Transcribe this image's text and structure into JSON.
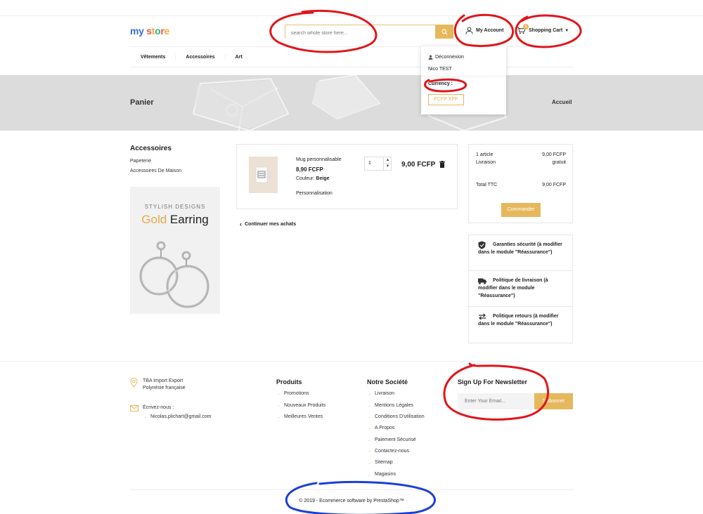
{
  "header": {
    "logo_parts": [
      "m",
      "y",
      " ",
      "s",
      "t",
      "o",
      "r",
      "e"
    ],
    "logo_text": "my store",
    "search_placeholder": "search whole store here...",
    "account_label": "My Account",
    "cart_label": "Shopping Cart",
    "cart_count": "1"
  },
  "nav": {
    "items": [
      "Vêtements",
      "Accessoires",
      "Art"
    ]
  },
  "account_menu": {
    "logout": "Déconnexion",
    "user": "Nico TEST",
    "currency_label": "Currency :",
    "currency_value": "FCFP  XPF"
  },
  "banner": {
    "title": "Panier",
    "home": "Accueil"
  },
  "sidebar": {
    "title": "Accessoires",
    "items": [
      "Papeterie",
      "Accessoires De Maison"
    ],
    "promo_sub": "STYLISH DESIGNS",
    "promo_gold": "Gold",
    "promo_black": "Earring"
  },
  "cart_line": {
    "name": "Mug personnalisable",
    "price": "8,90 FCFP",
    "color_label": "Couleur:",
    "color_value": "Beige",
    "customization": "Personnalisation",
    "qty": "1",
    "total": "9,00 FCFP"
  },
  "continue_label": "Continuer mes achats",
  "summary": {
    "rows": [
      {
        "label": "1 article",
        "value": "9,00 FCFP"
      },
      {
        "label": "Livraison",
        "value": "gratuit"
      },
      {
        "label": "Total TTC",
        "value": "9,00 FCFP"
      }
    ],
    "order_button": "Commander"
  },
  "reassurance": [
    {
      "text": "Garanties sécurité (à modifier dans le module \"Réassurance\")",
      "icon": "shield-icon"
    },
    {
      "text": "Politique de livraison (à modifier dans le module \"Réassurance\")",
      "icon": "truck-icon"
    },
    {
      "text": "Politique retours (à modifier dans le module \"Réassurance\")",
      "icon": "exchange-icon"
    }
  ],
  "footer": {
    "address_line1": "TBA Import Export",
    "address_line2": "Polynésie française",
    "write_label": "Écrivez-nous :",
    "email": "Nicolas.plichart@gmail.com",
    "products_title": "Produits",
    "products": [
      "Promotions",
      "Nouveaux Produits",
      "Meilleures Ventes"
    ],
    "company_title": "Notre Société",
    "company": [
      "Livraison",
      "Mentions Légales",
      "Conditions D'utilisation",
      "A Propos",
      "Paiement Sécurisé",
      "Contactez-nous",
      "Sitemap",
      "Magasins"
    ],
    "newsletter_title": "Sign Up For Newsletter",
    "email_placeholder": "Enter Your Email...",
    "subscribe": "S'abonner",
    "copyright": "© 2019 - Ecommerce software by PrestaShop™"
  },
  "colors": {
    "accent": "#e6b85c",
    "annotation_red": "#e0161b",
    "annotation_blue": "#1c3fd8"
  }
}
